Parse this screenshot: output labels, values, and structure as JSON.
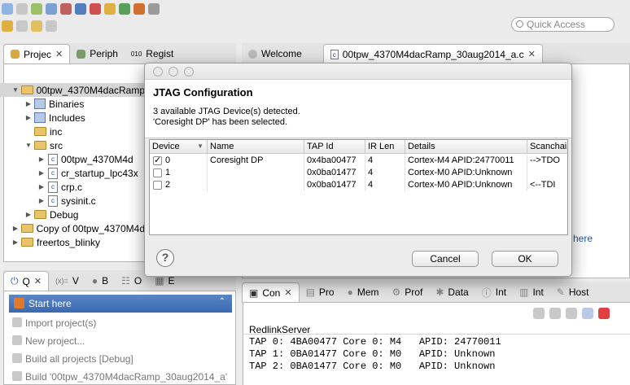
{
  "quick_access": {
    "placeholder": "Quick Access"
  },
  "project_panel": {
    "tabs": [
      "Projec",
      "Periph",
      "Regist"
    ],
    "tree": [
      {
        "label": "00tpw_4370M4dacRamp",
        "indent": 0,
        "expanded": true,
        "kind": "folder"
      },
      {
        "label": "Binaries",
        "indent": 1,
        "expanded": false,
        "kind": "bin"
      },
      {
        "label": "Includes",
        "indent": 1,
        "expanded": false,
        "kind": "bin"
      },
      {
        "label": "inc",
        "indent": 1,
        "expanded": null,
        "kind": "folder"
      },
      {
        "label": "src",
        "indent": 1,
        "expanded": true,
        "kind": "folder"
      },
      {
        "label": "00tpw_4370M4d",
        "indent": 2,
        "expanded": false,
        "kind": "file"
      },
      {
        "label": "cr_startup_lpc43x",
        "indent": 2,
        "expanded": false,
        "kind": "file"
      },
      {
        "label": "crp.c",
        "indent": 2,
        "expanded": false,
        "kind": "file"
      },
      {
        "label": "sysinit.c",
        "indent": 2,
        "expanded": false,
        "kind": "file"
      },
      {
        "label": "Debug",
        "indent": 1,
        "expanded": false,
        "kind": "folder"
      },
      {
        "label": "Copy of 00tpw_4370M4d",
        "indent": 0,
        "expanded": false,
        "kind": "folder"
      },
      {
        "label": "freertos_blinky",
        "indent": 0,
        "expanded": false,
        "kind": "folder"
      }
    ]
  },
  "editor": {
    "tabs": [
      "Welcome",
      "00tpw_4370M4dacRamp_30aug2014_a.c"
    ],
    "peek_text": "here"
  },
  "quickstart": {
    "tabs": [
      "Q",
      "V",
      "B",
      "O",
      "E"
    ],
    "header": "Start here",
    "items": [
      "Import project(s)",
      "New project...",
      "Build all projects [Debug]",
      "Build '00tpw_4370M4dacRamp_30aug2014_a'"
    ]
  },
  "console": {
    "tabs": [
      "Con",
      "Pro",
      "Mem",
      "Prof",
      "Data",
      "Int",
      "Int",
      "Host"
    ],
    "title": "RedlinkServer",
    "lines": [
      "TAP 0: 4BA00477 Core 0: M4   APID: 24770011",
      "TAP 1: 0BA01477 Core 0: M0   APID: Unknown",
      "TAP 2: 0BA01477 Core 0: M0   APID: Unknown"
    ]
  },
  "dialog": {
    "title": "JTAG Configuration",
    "line1": "3 available JTAG Device(s) detected.",
    "line2": "'Coresight DP' has been selected.",
    "columns": [
      "Device",
      "Name",
      "TAP Id",
      "IR Len",
      "Details",
      "Scanchai"
    ],
    "rows": [
      {
        "checked": true,
        "device": "0",
        "name": "Coresight DP",
        "tap": "0x4ba00477",
        "ir": "4",
        "details": "Cortex-M4 APID:24770011",
        "scan": "-->TDO"
      },
      {
        "checked": false,
        "device": "1",
        "name": "",
        "tap": "0x0ba01477",
        "ir": "4",
        "details": "Cortex-M0 APID:Unknown",
        "scan": ""
      },
      {
        "checked": false,
        "device": "2",
        "name": "",
        "tap": "0x0ba01477",
        "ir": "4",
        "details": "Cortex-M0 APID:Unknown",
        "scan": "<--TDI"
      }
    ],
    "cancel": "Cancel",
    "ok": "OK",
    "help": "?"
  }
}
